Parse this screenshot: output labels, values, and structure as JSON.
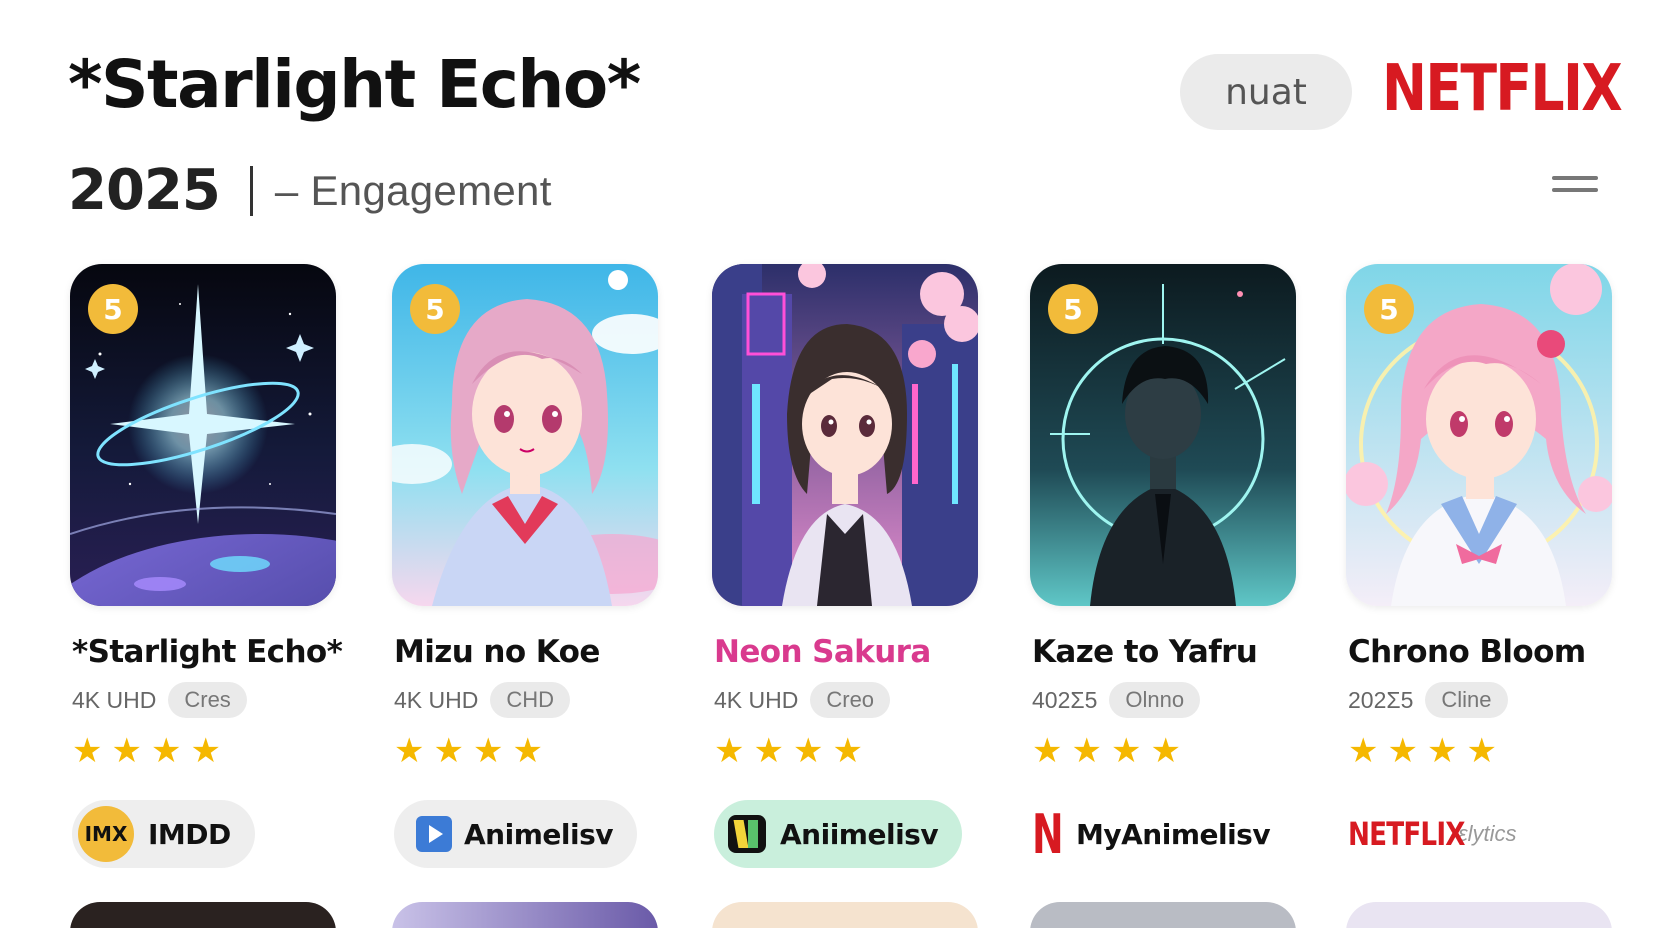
{
  "header": {
    "title": "*Starlight Echo*",
    "year": "2025",
    "subtitle": "– Engagement",
    "pill_label": "nuat",
    "brand": "NETFLIX",
    "menu_icon": "hamburger-menu-icon"
  },
  "colors": {
    "brand_red": "#d71a21",
    "badge_gold": "#f2bb3a",
    "star_gold": "#f5b800",
    "pink_title": "#d93a8e"
  },
  "cards": [
    {
      "rank": "5",
      "title": "*Starlight Echo*",
      "meta": "4K UHD",
      "chip": "Cres",
      "stars": "★★★★",
      "source": "IMDD",
      "source_logo": "IMX",
      "rating": 4
    },
    {
      "rank": "5",
      "title": "Mizu no Koe",
      "meta": "4K UHD",
      "chip": "CHD",
      "stars": "★★★★",
      "source": "Animelisv",
      "source_logo": "play-icon",
      "rating": 4
    },
    {
      "rank": "",
      "title": "Neon Sakura",
      "meta": "4K UHD",
      "chip": "Creo",
      "stars": "★★★★",
      "source": "Aniimelisv",
      "source_logo": "green-app-icon",
      "rating": 4
    },
    {
      "rank": "5",
      "title": "Kaze to Yafru",
      "meta": "402Σ5",
      "chip": "Olnno",
      "stars": "★★★★",
      "source": "MyAnimelisv",
      "source_logo": "N",
      "rating": 4
    },
    {
      "rank": "5",
      "title": "Chrono Bloom",
      "meta": "202Σ5",
      "chip": "Cline",
      "stars": "★★★★",
      "source_brand": "NETFLIX",
      "source_suffix": "ɛlytics",
      "rating": 4
    }
  ]
}
